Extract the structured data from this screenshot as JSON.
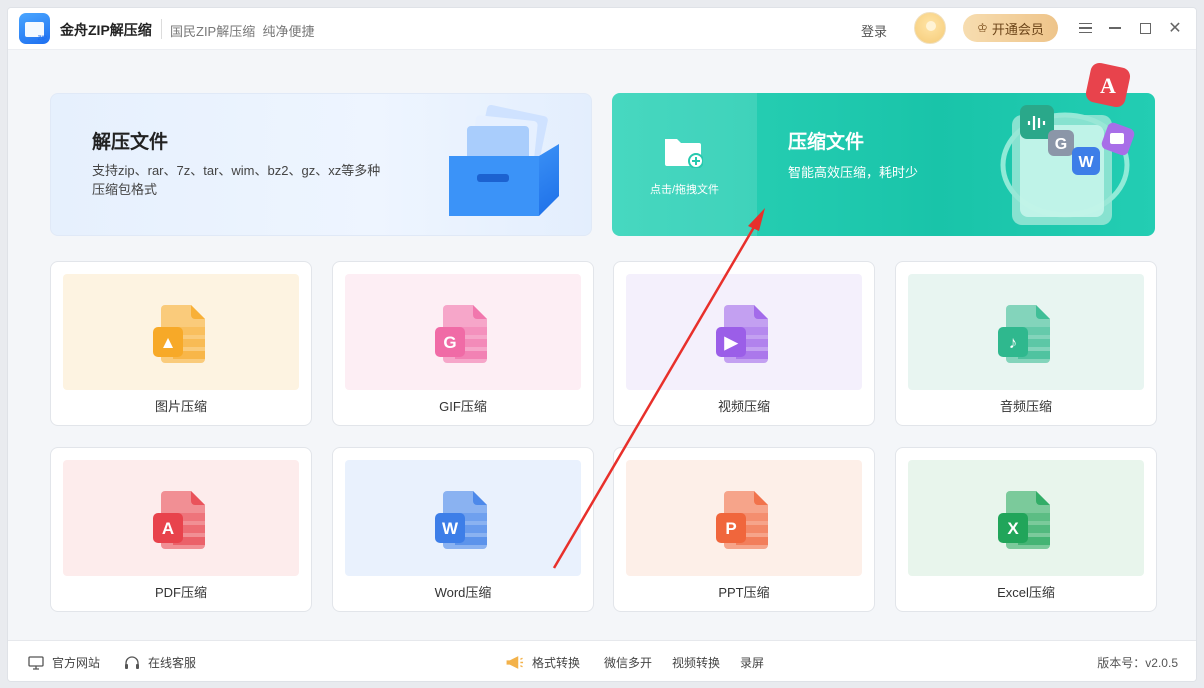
{
  "header": {
    "app_name": "金舟ZIP解压缩",
    "slogan": "国民ZIP解压缩  纯净便捷",
    "login": "登录",
    "vip_label": "开通会员",
    "logo_text": "ZIP"
  },
  "banners": {
    "extract": {
      "title": "解压文件",
      "desc": "支持zip、rar、7z、tar、wim、bz2、gz、xz等多种压缩包格式"
    },
    "compress": {
      "drop_text": "点击/拖拽文件",
      "title": "压缩文件",
      "desc": "智能高效压缩，耗时少"
    }
  },
  "cards": [
    {
      "label": "图片压缩",
      "icon": "image-file-icon",
      "bg": "#fdf3e1",
      "color": "#f7a928",
      "glyph": "▲"
    },
    {
      "label": "GIF压缩",
      "icon": "gif-file-icon",
      "bg": "#fdeef4",
      "color": "#f06ba6",
      "glyph": "G"
    },
    {
      "label": "视频压缩",
      "icon": "video-file-icon",
      "bg": "#f4f0fc",
      "color": "#9b5ee8",
      "glyph": "▶"
    },
    {
      "label": "音频压缩",
      "icon": "audio-file-icon",
      "bg": "#e8f5f1",
      "color": "#2fb88e",
      "glyph": "♪"
    },
    {
      "label": "PDF压缩",
      "icon": "pdf-file-icon",
      "bg": "#fdecec",
      "color": "#e8434c",
      "glyph": "A"
    },
    {
      "label": "Word压缩",
      "icon": "word-file-icon",
      "bg": "#e9f1fd",
      "color": "#3d7ee8",
      "glyph": "W"
    },
    {
      "label": "PPT压缩",
      "icon": "ppt-file-icon",
      "bg": "#fdefe8",
      "color": "#f0663c",
      "glyph": "P"
    },
    {
      "label": "Excel压缩",
      "icon": "excel-file-icon",
      "bg": "#e8f5ec",
      "color": "#21a55a",
      "glyph": "X"
    }
  ],
  "footer": {
    "website": "官方网站",
    "service": "在线客服",
    "format_convert": "格式转换",
    "wechat_multi": "微信多开",
    "video_convert": "视频转换",
    "record": "录屏",
    "version": "版本号：v2.0.5"
  }
}
